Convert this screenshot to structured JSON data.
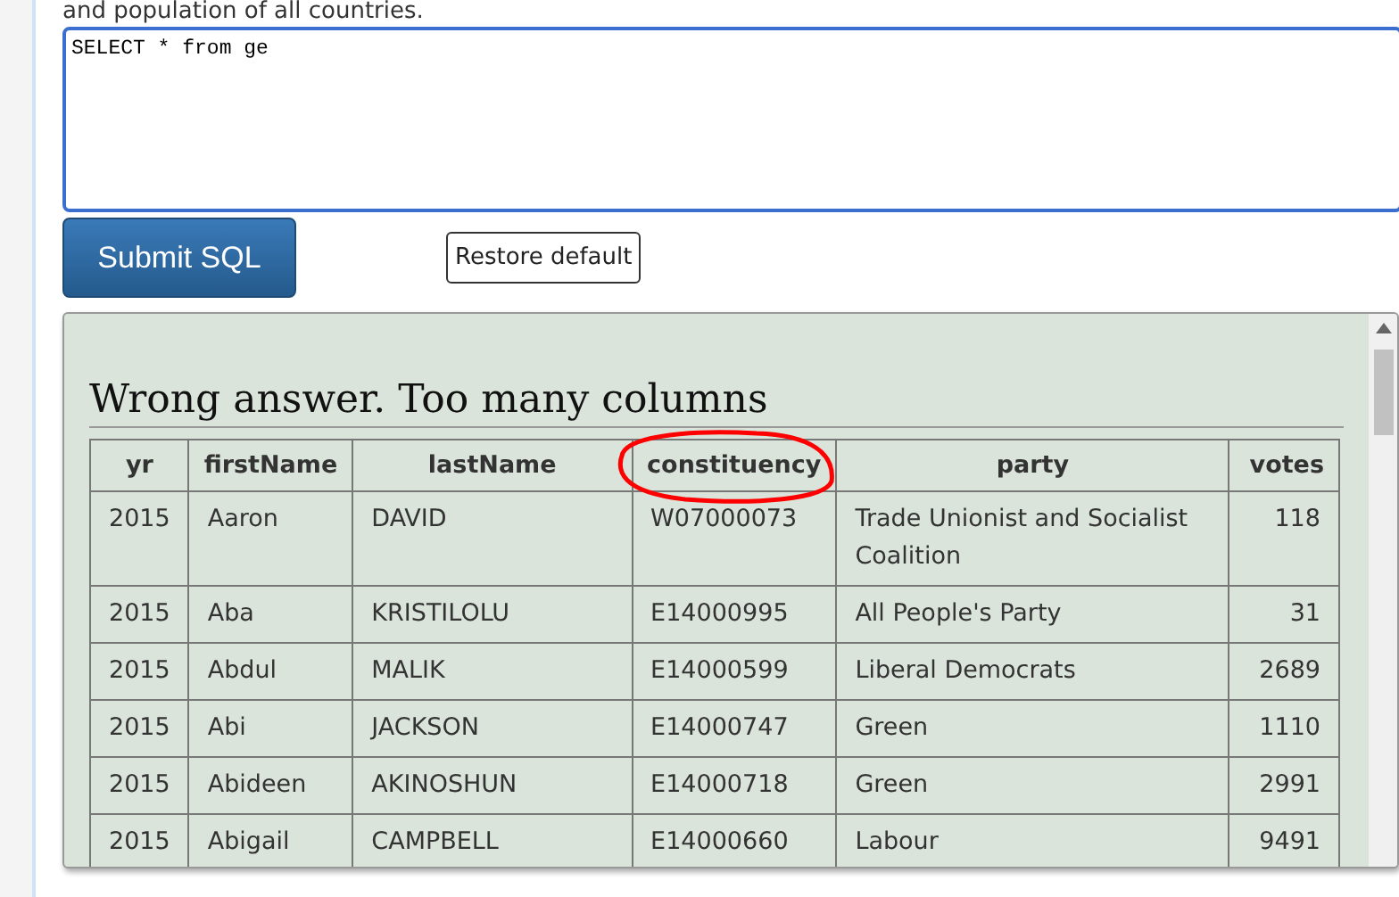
{
  "intro": "and population of all countries.",
  "sql_editor": {
    "value": "SELECT * from ge"
  },
  "buttons": {
    "submit": "Submit SQL",
    "restore": "Restore default"
  },
  "result": {
    "heading": "Wrong answer. Too many columns",
    "table": {
      "columns": [
        "yr",
        "firstName",
        "lastName",
        "constituency",
        "party",
        "votes"
      ],
      "rows": [
        [
          "2015",
          "Aaron",
          "DAVID",
          "W07000073",
          "Trade Unionist and Socialist Coalition",
          "118"
        ],
        [
          "2015",
          "Aba",
          "KRISTILOLU",
          "E14000995",
          "All People's Party",
          "31"
        ],
        [
          "2015",
          "Abdul",
          "MALIK",
          "E14000599",
          "Liberal Democrats",
          "2689"
        ],
        [
          "2015",
          "Abi",
          "JACKSON",
          "E14000747",
          "Green",
          "1110"
        ],
        [
          "2015",
          "Abideen",
          "AKINOSHUN",
          "E14000718",
          "Green",
          "2991"
        ],
        [
          "2015",
          "Abigail",
          "CAMPBELL",
          "E14000660",
          "Labour",
          "9491"
        ]
      ]
    }
  }
}
